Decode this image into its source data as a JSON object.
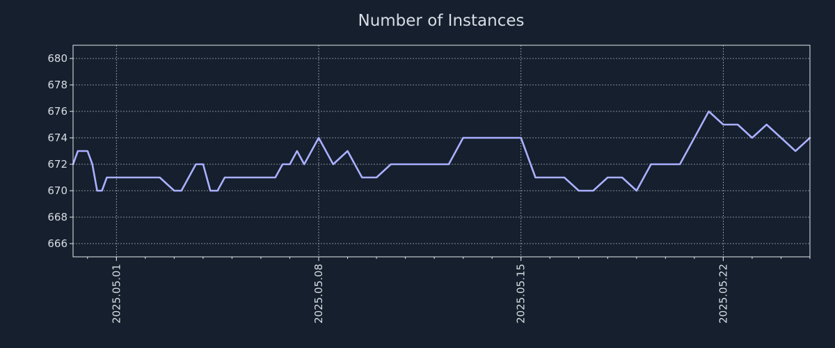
{
  "chart_data": {
    "type": "line",
    "title": "Number of Instances",
    "xlabel": "",
    "ylabel": "",
    "x_range": [
      "2025-04-29",
      "2025-05-25"
    ],
    "ylim": [
      665,
      681
    ],
    "y_ticks": [
      666,
      668,
      670,
      672,
      674,
      676,
      678,
      680
    ],
    "x_ticks": [
      {
        "date": "2025-05-01",
        "label": "2025.05.01"
      },
      {
        "date": "2025-05-08",
        "label": "2025.05.08"
      },
      {
        "date": "2025-05-15",
        "label": "2025.05.15"
      },
      {
        "date": "2025-05-22",
        "label": "2025.05.22"
      }
    ],
    "grid": true,
    "colors": {
      "background": "#151f2d",
      "line": "#aab0ff"
    },
    "series": [
      {
        "x": [
          "2025-04-29 12:00",
          "2025-04-29 16:00",
          "2025-04-30 00:00",
          "2025-04-30 04:00",
          "2025-04-30 08:00",
          "2025-04-30 12:00",
          "2025-04-30 16:00",
          "2025-05-01 00:00",
          "2025-05-01 12:00",
          "2025-05-02 00:00",
          "2025-05-02 12:00",
          "2025-05-03 00:00",
          "2025-05-03 06:00",
          "2025-05-03 12:00",
          "2025-05-03 18:00",
          "2025-05-04 00:00",
          "2025-05-04 06:00",
          "2025-05-04 12:00",
          "2025-05-04 18:00",
          "2025-05-05 00:00",
          "2025-05-05 12:00",
          "2025-05-06 00:00",
          "2025-05-06 12:00",
          "2025-05-06 18:00",
          "2025-05-07 00:00",
          "2025-05-07 06:00",
          "2025-05-07 12:00",
          "2025-05-07 18:00",
          "2025-05-08 00:00",
          "2025-05-08 06:00",
          "2025-05-08 12:00",
          "2025-05-09 00:00",
          "2025-05-09 12:00",
          "2025-05-10 00:00",
          "2025-05-10 12:00",
          "2025-05-11 00:00",
          "2025-05-11 12:00",
          "2025-05-12 00:00",
          "2025-05-12 12:00",
          "2025-05-13 00:00",
          "2025-05-13 06:00",
          "2025-05-13 12:00",
          "2025-05-14 00:00",
          "2025-05-14 12:00",
          "2025-05-15 00:00",
          "2025-05-15 12:00",
          "2025-05-16 00:00",
          "2025-05-16 12:00",
          "2025-05-17 00:00",
          "2025-05-17 12:00",
          "2025-05-18 00:00",
          "2025-05-18 12:00",
          "2025-05-19 00:00",
          "2025-05-19 12:00",
          "2025-05-20 00:00",
          "2025-05-20 12:00",
          "2025-05-21 00:00",
          "2025-05-21 12:00",
          "2025-05-22 00:00",
          "2025-05-22 12:00",
          "2025-05-23 00:00",
          "2025-05-23 12:00",
          "2025-05-24 00:00",
          "2025-05-24 12:00",
          "2025-05-25 00:00"
        ],
        "y": [
          672,
          673,
          673,
          672,
          670,
          670,
          671,
          671,
          671,
          671,
          671,
          670,
          670,
          671,
          672,
          672,
          670,
          670,
          671,
          671,
          671,
          671,
          671,
          672,
          672,
          673,
          672,
          673,
          674,
          673,
          672,
          673,
          671,
          671,
          672,
          672,
          672,
          672,
          672,
          674,
          674,
          674,
          674,
          674,
          674,
          671,
          671,
          671,
          670,
          670,
          671,
          671,
          670,
          672,
          672,
          672,
          674,
          676,
          675,
          675,
          674,
          675,
          674,
          673,
          674
        ]
      }
    ]
  }
}
